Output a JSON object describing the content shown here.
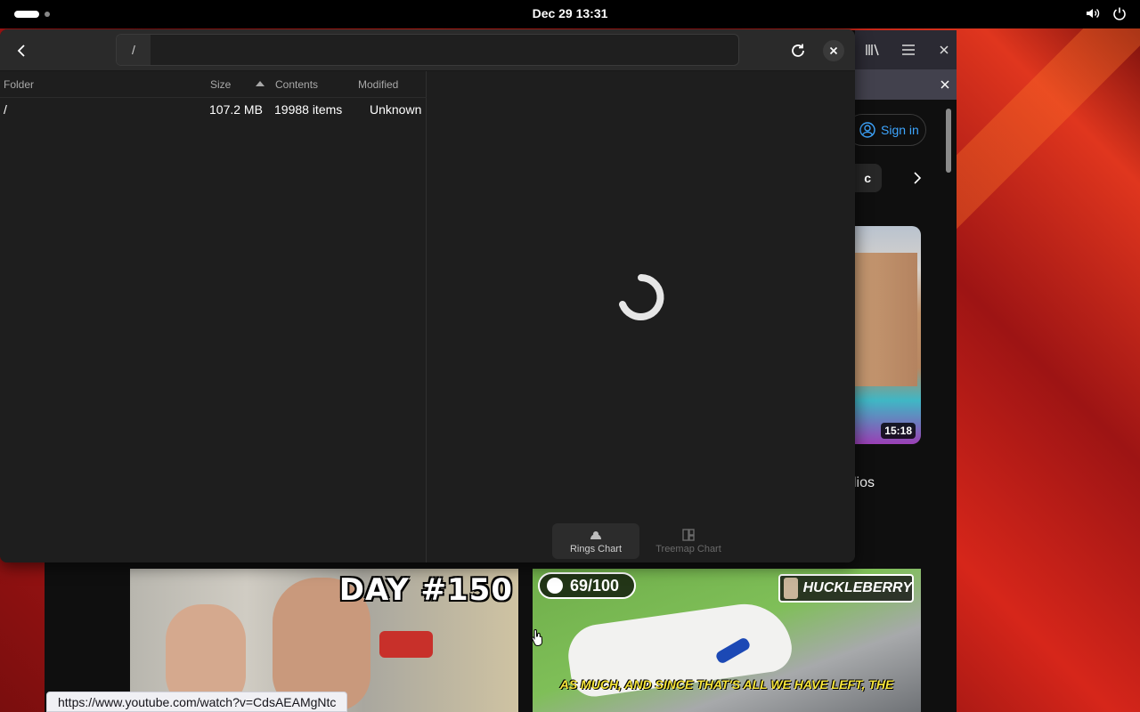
{
  "topbar": {
    "clock": "Dec 29  13:31",
    "icons": [
      "activities-indicator",
      "volume-icon",
      "power-icon"
    ]
  },
  "baobab": {
    "path": "/",
    "columns": {
      "folder": "Folder",
      "size": "Size",
      "contents": "Contents",
      "modified": "Modified"
    },
    "rows": [
      {
        "folder": "/",
        "size": "107.2 MB",
        "contents": "19988 items",
        "modified": "Unknown"
      }
    ],
    "chart_switcher": {
      "rings": "Rings Chart",
      "treemap": "Treemap Chart",
      "active": "rings"
    },
    "loading": true
  },
  "browser": {
    "sign_in": "Sign in",
    "chip_fragment": "c",
    "video_duration": "15:18",
    "text_fragment": "lios",
    "thumb1_overlay": "DAY #150",
    "thumb2_count": "69/100",
    "thumb2_name": "HUCKLEBERRY",
    "thumb2_caption": "AS MUCH, AND SINCE THAT'S ALL WE HAVE LEFT, THE",
    "status_url": "https://www.youtube.com/watch?v=CdsAEAMgNtc"
  },
  "colors": {
    "accent_link": "#3ea6ff",
    "window_bg": "#1e1e1e",
    "headerbar_bg": "#2a2a2a",
    "wallpaper": "#c01818"
  }
}
